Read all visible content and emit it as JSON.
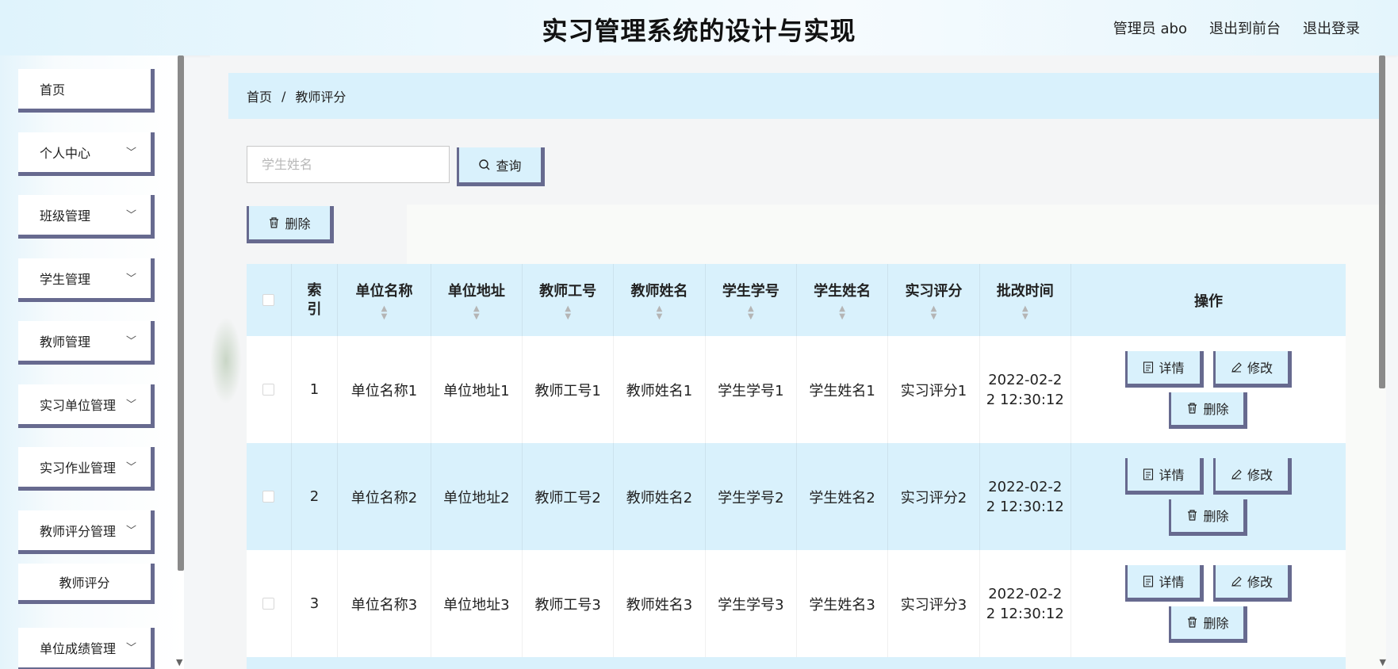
{
  "header": {
    "title": "实习管理系统的设计与实现",
    "admin_label": "管理员 abo",
    "front_label": "退出到前台",
    "logout_label": "退出登录"
  },
  "sidebar": {
    "items": [
      {
        "label": "首页",
        "expandable": false
      },
      {
        "label": "个人中心",
        "expandable": true
      },
      {
        "label": "班级管理",
        "expandable": true
      },
      {
        "label": "学生管理",
        "expandable": true
      },
      {
        "label": "教师管理",
        "expandable": true
      },
      {
        "label": "实习单位管理",
        "expandable": true
      },
      {
        "label": "实习作业管理",
        "expandable": true
      },
      {
        "label": "教师评分管理",
        "expandable": true
      }
    ],
    "subitem": "教师评分",
    "last_item": "单位成绩管理"
  },
  "breadcrumb": {
    "home": "首页",
    "separator": "/",
    "current": "教师评分"
  },
  "search": {
    "placeholder": "学生姓名",
    "button_label": "查询"
  },
  "toolbar": {
    "delete_label": "删除"
  },
  "table": {
    "headers": {
      "index": "索\n引",
      "unit_name": "单位名称",
      "unit_address": "单位地址",
      "teacher_id": "教师工号",
      "teacher_name": "教师姓名",
      "student_id": "学生学号",
      "student_name": "学生姓名",
      "score": "实习评分",
      "time": "批改时间",
      "ops": "操作"
    },
    "rows": [
      {
        "index": "1",
        "unit_name": "单位名称1",
        "unit_address": "单位地址1",
        "teacher_id": "教师工号1",
        "teacher_name": "教师姓名1",
        "student_id": "学生学号1",
        "student_name": "学生姓名1",
        "score": "实习评分1",
        "time": "2022-02-2\n2 12:30:12"
      },
      {
        "index": "2",
        "unit_name": "单位名称2",
        "unit_address": "单位地址2",
        "teacher_id": "教师工号2",
        "teacher_name": "教师姓名2",
        "student_id": "学生学号2",
        "student_name": "学生姓名2",
        "score": "实习评分2",
        "time": "2022-02-2\n2 12:30:12"
      },
      {
        "index": "3",
        "unit_name": "单位名称3",
        "unit_address": "单位地址3",
        "teacher_id": "教师工号3",
        "teacher_name": "教师姓名3",
        "student_id": "学生学号3",
        "student_name": "学生姓名3",
        "score": "实习评分3",
        "time": "2022-02-2\n2 12:30:12"
      }
    ],
    "ops": {
      "detail": "详情",
      "edit": "修改",
      "delete": "删除"
    }
  },
  "colors": {
    "accent_light": "#d9f1fc",
    "button_border": "#676a8f"
  }
}
